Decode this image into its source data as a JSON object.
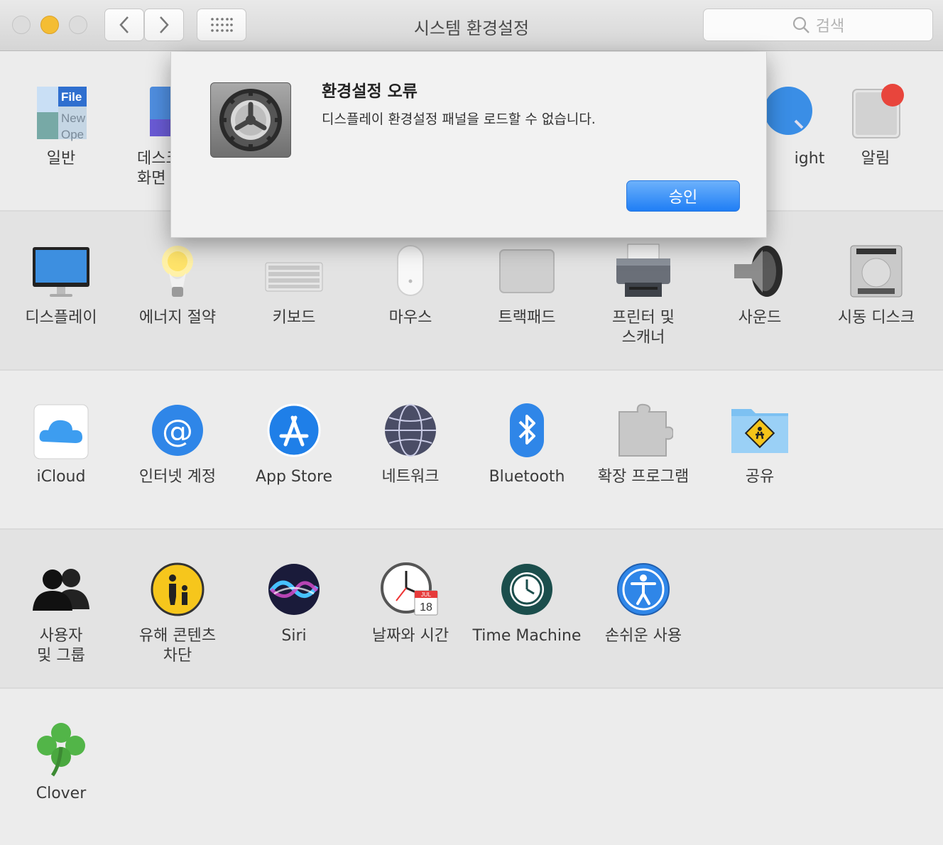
{
  "window": {
    "title": "시스템 환경설정"
  },
  "search": {
    "placeholder": "검색"
  },
  "dialog": {
    "title": "환경설정 오류",
    "message": "디스플레이 환경설정 패널을 로드할 수 없습니다.",
    "confirm_label": "승인"
  },
  "rows": {
    "row1": [
      "일반",
      "데스크\n화면",
      "ight",
      "알림"
    ],
    "row2": [
      "디스플레이",
      "에너지 절약",
      "키보드",
      "마우스",
      "트랙패드",
      "프린터 및\n스캐너",
      "사운드",
      "시동 디스크"
    ],
    "row3": [
      "iCloud",
      "인터넷 계정",
      "App Store",
      "네트워크",
      "Bluetooth",
      "확장 프로그램",
      "공유"
    ],
    "row4": [
      "사용자\n및 그룹",
      "유해 콘텐츠\n차단",
      "Siri",
      "날짜와 시간",
      "Time Machine",
      "손쉬운 사용"
    ],
    "row5": [
      "Clover"
    ]
  },
  "icons": {
    "general": "general-icon",
    "desktop": "desktop-icon",
    "spotlight": "spotlight-icon",
    "notifications": "notifications-icon",
    "calendar_month": "JUL",
    "calendar_day": "18",
    "file_icon_text": [
      "File",
      "New",
      "Ope"
    ]
  }
}
